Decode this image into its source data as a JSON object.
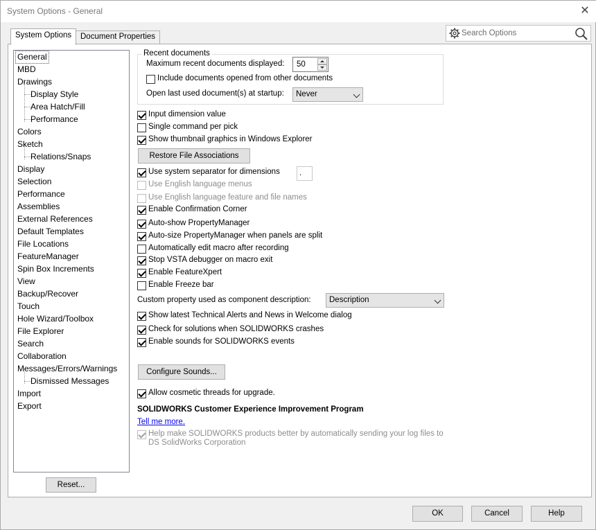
{
  "window": {
    "title": "System Options - General",
    "close_glyph": "✕"
  },
  "tabs": [
    {
      "label": "System Options",
      "active": true
    },
    {
      "label": "Document Properties",
      "active": false
    }
  ],
  "search": {
    "placeholder": "Search Options"
  },
  "tree": {
    "items": [
      {
        "label": "General",
        "selected": true,
        "level": 0
      },
      {
        "label": "MBD",
        "level": 0
      },
      {
        "label": "Drawings",
        "level": 0
      },
      {
        "label": "Display Style",
        "level": 1
      },
      {
        "label": "Area Hatch/Fill",
        "level": 1
      },
      {
        "label": "Performance",
        "level": 1
      },
      {
        "label": "Colors",
        "level": 0
      },
      {
        "label": "Sketch",
        "level": 0
      },
      {
        "label": "Relations/Snaps",
        "level": 1
      },
      {
        "label": "Display",
        "level": 0
      },
      {
        "label": "Selection",
        "level": 0
      },
      {
        "label": "Performance",
        "level": 0
      },
      {
        "label": "Assemblies",
        "level": 0
      },
      {
        "label": "External References",
        "level": 0
      },
      {
        "label": "Default Templates",
        "level": 0
      },
      {
        "label": "File Locations",
        "level": 0
      },
      {
        "label": "FeatureManager",
        "level": 0
      },
      {
        "label": "Spin Box Increments",
        "level": 0
      },
      {
        "label": "View",
        "level": 0
      },
      {
        "label": "Backup/Recover",
        "level": 0
      },
      {
        "label": "Touch",
        "level": 0
      },
      {
        "label": "Hole Wizard/Toolbox",
        "level": 0
      },
      {
        "label": "File Explorer",
        "level": 0
      },
      {
        "label": "Search",
        "level": 0
      },
      {
        "label": "Collaboration",
        "level": 0
      },
      {
        "label": "Messages/Errors/Warnings",
        "level": 0
      },
      {
        "label": "Dismissed Messages",
        "level": 1
      },
      {
        "label": "Import",
        "level": 0
      },
      {
        "label": "Export",
        "level": 0
      }
    ]
  },
  "reset_label": "Reset...",
  "recent": {
    "group_title": "Recent documents",
    "max_label": "Maximum recent documents displayed:",
    "max_value": "50",
    "include_label": "Include documents opened from other documents",
    "include_checked": false,
    "open_last_label": "Open last used document(s) at startup:",
    "open_last_value": "Never"
  },
  "options": {
    "input_dimension": {
      "label": "Input dimension value",
      "checked": true
    },
    "single_command": {
      "label": "Single command per pick",
      "checked": false
    },
    "show_thumbnail": {
      "label": "Show thumbnail graphics in Windows Explorer",
      "checked": true
    },
    "restore_assoc_label": "Restore File Associations",
    "system_separator": {
      "label": "Use system separator for dimensions",
      "checked": true,
      "separator_value": "."
    },
    "english_menus": {
      "label": "Use English language menus",
      "checked": false,
      "disabled": true
    },
    "english_feature": {
      "label": "Use English language feature and file names",
      "checked": false,
      "disabled": true
    },
    "confirmation_corner": {
      "label": "Enable Confirmation Corner",
      "checked": true
    },
    "auto_show_pm": {
      "label": "Auto-show PropertyManager",
      "checked": true
    },
    "auto_size_pm": {
      "label": "Auto-size PropertyManager when panels are split",
      "checked": true
    },
    "auto_edit_macro": {
      "label": "Automatically edit macro after recording",
      "checked": false
    },
    "stop_vsta": {
      "label": "Stop VSTA debugger on macro exit",
      "checked": true
    },
    "feature_xpert": {
      "label": "Enable FeatureXpert",
      "checked": true
    },
    "freeze_bar": {
      "label": "Enable Freeze bar",
      "checked": false
    },
    "custom_prop_label": "Custom property used as component description:",
    "custom_prop_value": "Description",
    "technical_alerts": {
      "label": "Show latest Technical Alerts and News in Welcome dialog",
      "checked": true
    },
    "check_solutions": {
      "label": "Check for solutions when SOLIDWORKS crashes",
      "checked": true
    },
    "enable_sounds": {
      "label": "Enable sounds for SOLIDWORKS events",
      "checked": true
    },
    "configure_sounds_label": "Configure Sounds...",
    "cosmetic_threads": {
      "label": "Allow cosmetic threads for upgrade.",
      "checked": true
    },
    "ceip_title": "SOLIDWORKS Customer Experience Improvement Program",
    "tell_me_more": "Tell me more.",
    "ceip_help": {
      "label_line1": "Help make SOLIDWORKS products better by automatically sending your log files to",
      "label_line2": "DS SolidWorks Corporation",
      "checked": true,
      "disabled": true
    }
  },
  "footer": {
    "ok": "OK",
    "cancel": "Cancel",
    "help": "Help"
  }
}
